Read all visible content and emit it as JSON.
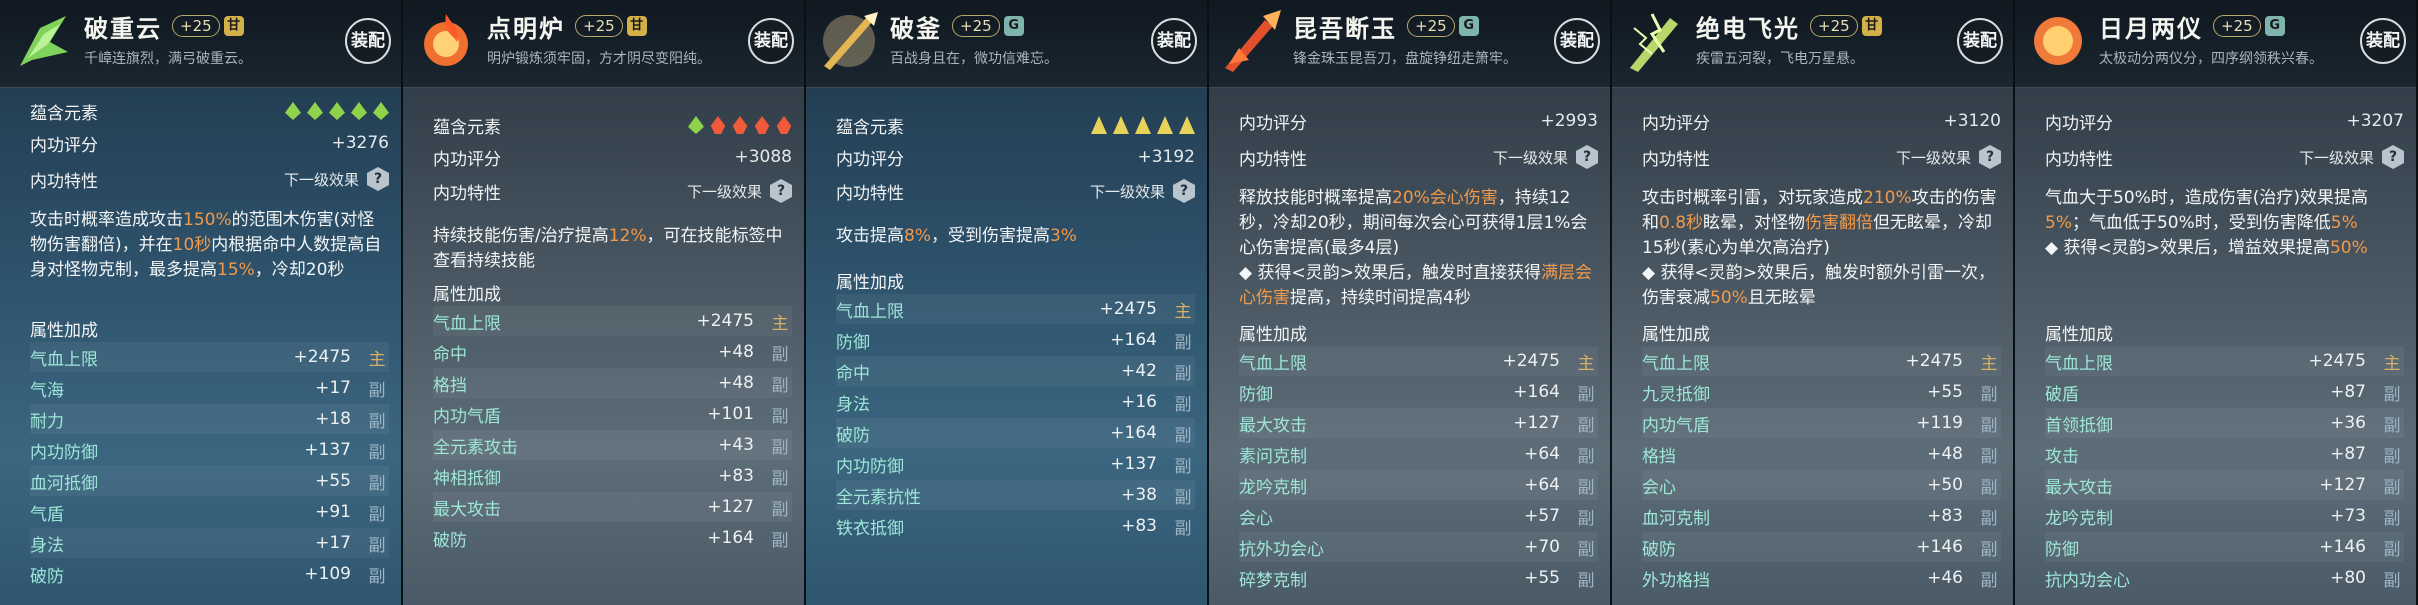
{
  "panels": [
    {
      "title": "破重云",
      "level": "+25",
      "grade": "甘",
      "grade_color": "gold",
      "subtitle": "千嶂连旗烈，满弓破重云。",
      "equip": "装配",
      "icon": "green-blade-icon",
      "accent": "#7fd35a",
      "element_label": "蕴含元素",
      "elements": [
        "wood",
        "wood",
        "wood",
        "wood",
        "wood"
      ],
      "score_label": "内功评分",
      "score": "+3276",
      "trait_label": "内功特性",
      "next_effect": "下一级效果",
      "desc_html": "攻击时概率造成攻击<span class='hl'>150%</span>的范围木伤害(对怪物伤害翻倍)，并在<span class='hl'>10秒</span>内根据命中人数提高自身对怪物克制，最多提高<span class='hl'>15%</span>，冷却20秒",
      "attr_title": "属性加成",
      "attrs": [
        {
          "name": "气血上限",
          "value": "+2475",
          "tag": "主"
        },
        {
          "name": "气海",
          "value": "+17",
          "tag": "副"
        },
        {
          "name": "耐力",
          "value": "+18",
          "tag": "副"
        },
        {
          "name": "内功防御",
          "value": "+137",
          "tag": "副"
        },
        {
          "name": "血河抵御",
          "value": "+55",
          "tag": "副"
        },
        {
          "name": "气盾",
          "value": "+91",
          "tag": "副"
        },
        {
          "name": "身法",
          "value": "+17",
          "tag": "副"
        },
        {
          "name": "破防",
          "value": "+109",
          "tag": "副"
        }
      ]
    },
    {
      "title": "点明炉",
      "level": "+25",
      "grade": "甘",
      "grade_color": "gold",
      "subtitle": "明炉锻炼须牢固，方才阴尽变阳纯。",
      "equip": "装配",
      "icon": "flame-orb-icon",
      "accent": "#f0702f",
      "element_label": "蕴含元素",
      "elements": [
        "wood",
        "fire",
        "fire",
        "fire",
        "fire"
      ],
      "score_label": "内功评分",
      "score": "+3088",
      "trait_label": "内功特性",
      "next_effect": "下一级效果",
      "desc_html": "持续技能伤害/治疗提高<span class='hl'>12%</span>，可在技能标签中查看持续技能",
      "attr_title": "属性加成",
      "attrs": [
        {
          "name": "气血上限",
          "value": "+2475",
          "tag": "主"
        },
        {
          "name": "命中",
          "value": "+48",
          "tag": "副"
        },
        {
          "name": "格挡",
          "value": "+48",
          "tag": "副"
        },
        {
          "name": "内功气盾",
          "value": "+101",
          "tag": "副"
        },
        {
          "name": "全元素攻击",
          "value": "+43",
          "tag": "副"
        },
        {
          "name": "神相抵御",
          "value": "+83",
          "tag": "副"
        },
        {
          "name": "最大攻击",
          "value": "+127",
          "tag": "副"
        },
        {
          "name": "破防",
          "value": "+164",
          "tag": "副"
        }
      ]
    },
    {
      "title": "破釜",
      "level": "+25",
      "grade": "G",
      "grade_color": "teal",
      "subtitle": "百战身且在，微功信难忘。",
      "equip": "装配",
      "icon": "golden-spear-icon",
      "accent": "#e3b553",
      "element_label": "蕴含元素",
      "elements": [
        "earth",
        "earth",
        "earth",
        "earth",
        "earth"
      ],
      "score_label": "内功评分",
      "score": "+3192",
      "trait_label": "内功特性",
      "next_effect": "下一级效果",
      "desc_html": "攻击提高<span class='hl'>8%</span>，受到伤害提高<span class='hl'>3%</span>",
      "attr_title": "属性加成",
      "attrs": [
        {
          "name": "气血上限",
          "value": "+2475",
          "tag": "主"
        },
        {
          "name": "防御",
          "value": "+164",
          "tag": "副"
        },
        {
          "name": "命中",
          "value": "+42",
          "tag": "副"
        },
        {
          "name": "身法",
          "value": "+16",
          "tag": "副"
        },
        {
          "name": "破防",
          "value": "+164",
          "tag": "副"
        },
        {
          "name": "内功防御",
          "value": "+137",
          "tag": "副"
        },
        {
          "name": "全元素抗性",
          "value": "+38",
          "tag": "副"
        },
        {
          "name": "铁衣抵御",
          "value": "+83",
          "tag": "副"
        }
      ]
    },
    {
      "title": "昆吾断玉",
      "level": "+25",
      "grade": "G",
      "grade_color": "teal",
      "subtitle": "锋金珠玉昆吾刀，盘旋铮纽走箫牢。",
      "equip": "装配",
      "icon": "red-sword-icon",
      "accent": "#e2502c",
      "score_label": "内功评分",
      "score": "+2993",
      "trait_label": "内功特性",
      "next_effect": "下一级效果",
      "desc_html": "释放技能时概率提高<span class='hl'>20%会心伤害</span>，持续12秒，冷却20秒，期间每次会心可获得1层1%会心伤害提高(最多4层)<br>◆ 获得&lt;灵韵&gt;效果后，触发时直接获得<span class='hl'>满层会心伤害</span>提高，持续时间提高4秒",
      "attr_title": "属性加成",
      "attrs": [
        {
          "name": "气血上限",
          "value": "+2475",
          "tag": "主"
        },
        {
          "name": "防御",
          "value": "+164",
          "tag": "副"
        },
        {
          "name": "最大攻击",
          "value": "+127",
          "tag": "副"
        },
        {
          "name": "素问克制",
          "value": "+64",
          "tag": "副"
        },
        {
          "name": "龙吟克制",
          "value": "+64",
          "tag": "副"
        },
        {
          "name": "会心",
          "value": "+57",
          "tag": "副"
        },
        {
          "name": "抗外功会心",
          "value": "+70",
          "tag": "副"
        },
        {
          "name": "碎梦克制",
          "value": "+55",
          "tag": "副"
        }
      ]
    },
    {
      "title": "绝电飞光",
      "level": "+25",
      "grade": "甘",
      "grade_color": "gold",
      "subtitle": "疾雷五河裂，飞电万星悬。",
      "equip": "装配",
      "icon": "lightning-blade-icon",
      "accent": "#b6d86a",
      "score_label": "内功评分",
      "score": "+3120",
      "trait_label": "内功特性",
      "next_effect": "下一级效果",
      "desc_html": "攻击时概率引雷，对玩家造成<span class='hl'>210%</span>攻击的伤害和<span class='hl'>0.8秒</span>眩晕，对怪物<span class='hl'>伤害翻倍</span>但无眩晕，冷却15秒(素心为单次高治疗)<br>◆ 获得&lt;灵韵&gt;效果后，触发时额外引雷一次，伤害衰减<span class='hl'>50%</span>且无眩晕",
      "attr_title": "属性加成",
      "attrs": [
        {
          "name": "气血上限",
          "value": "+2475",
          "tag": "主"
        },
        {
          "name": "九灵抵御",
          "value": "+55",
          "tag": "副"
        },
        {
          "name": "内功气盾",
          "value": "+119",
          "tag": "副"
        },
        {
          "name": "格挡",
          "value": "+48",
          "tag": "副"
        },
        {
          "name": "会心",
          "value": "+50",
          "tag": "副"
        },
        {
          "name": "血河克制",
          "value": "+83",
          "tag": "副"
        },
        {
          "name": "破防",
          "value": "+146",
          "tag": "副"
        },
        {
          "name": "外功格挡",
          "value": "+46",
          "tag": "副"
        }
      ]
    },
    {
      "title": "日月两仪",
      "level": "+25",
      "grade": "G",
      "grade_color": "teal",
      "subtitle": "太极动分两仪分，四序纲领秩兴春。",
      "equip": "装配",
      "icon": "sun-moon-icon",
      "accent": "#ef7a3a",
      "score_label": "内功评分",
      "score": "+3207",
      "trait_label": "内功特性",
      "next_effect": "下一级效果",
      "desc_html": "气血大于50%时，造成伤害(治疗)效果提高<span class='hl'>5%</span>；气血低于50%时，受到伤害降低<span class='hl'>5%</span><br>◆ 获得&lt;灵韵&gt;效果后，增益效果提高<span class='hl'>50%</span>",
      "attr_title": "属性加成",
      "attrs": [
        {
          "name": "气血上限",
          "value": "+2475",
          "tag": "主"
        },
        {
          "name": "破盾",
          "value": "+87",
          "tag": "副"
        },
        {
          "name": "首领抵御",
          "value": "+36",
          "tag": "副"
        },
        {
          "name": "攻击",
          "value": "+87",
          "tag": "副"
        },
        {
          "name": "最大攻击",
          "value": "+127",
          "tag": "副"
        },
        {
          "name": "龙吟克制",
          "value": "+73",
          "tag": "副"
        },
        {
          "name": "防御",
          "value": "+146",
          "tag": "副"
        },
        {
          "name": "抗内功会心",
          "value": "+80",
          "tag": "副"
        }
      ]
    }
  ]
}
